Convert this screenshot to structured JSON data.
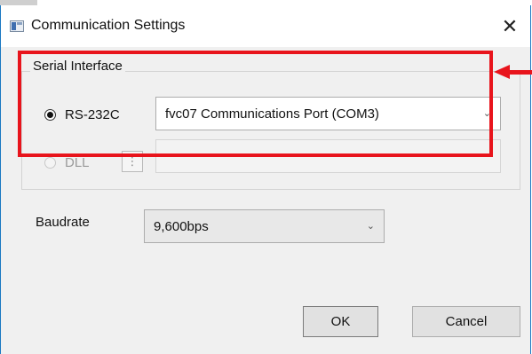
{
  "window": {
    "title": "Communication Settings",
    "close_glyph": "✕"
  },
  "serial_interface": {
    "legend": "Serial Interface",
    "rs232c": {
      "label": "RS-232C",
      "checked": true,
      "port_selected": "fvc07 Communications Port (COM3)"
    },
    "dll": {
      "label": "DLL",
      "checked": false,
      "enabled": false,
      "browse_label": "⋮",
      "path_value": ""
    }
  },
  "baudrate": {
    "label": "Baudrate",
    "selected": "9,600bps"
  },
  "buttons": {
    "ok": "OK",
    "cancel": "Cancel"
  },
  "annotation": {
    "highlight_color": "#e8141c"
  },
  "icons": {
    "app": "window-icon",
    "close": "close-icon",
    "dropdown": "chevron-down-icon",
    "browse": "ellipsis-icon",
    "arrow": "arrow-left-icon"
  },
  "chevron": "⌄"
}
